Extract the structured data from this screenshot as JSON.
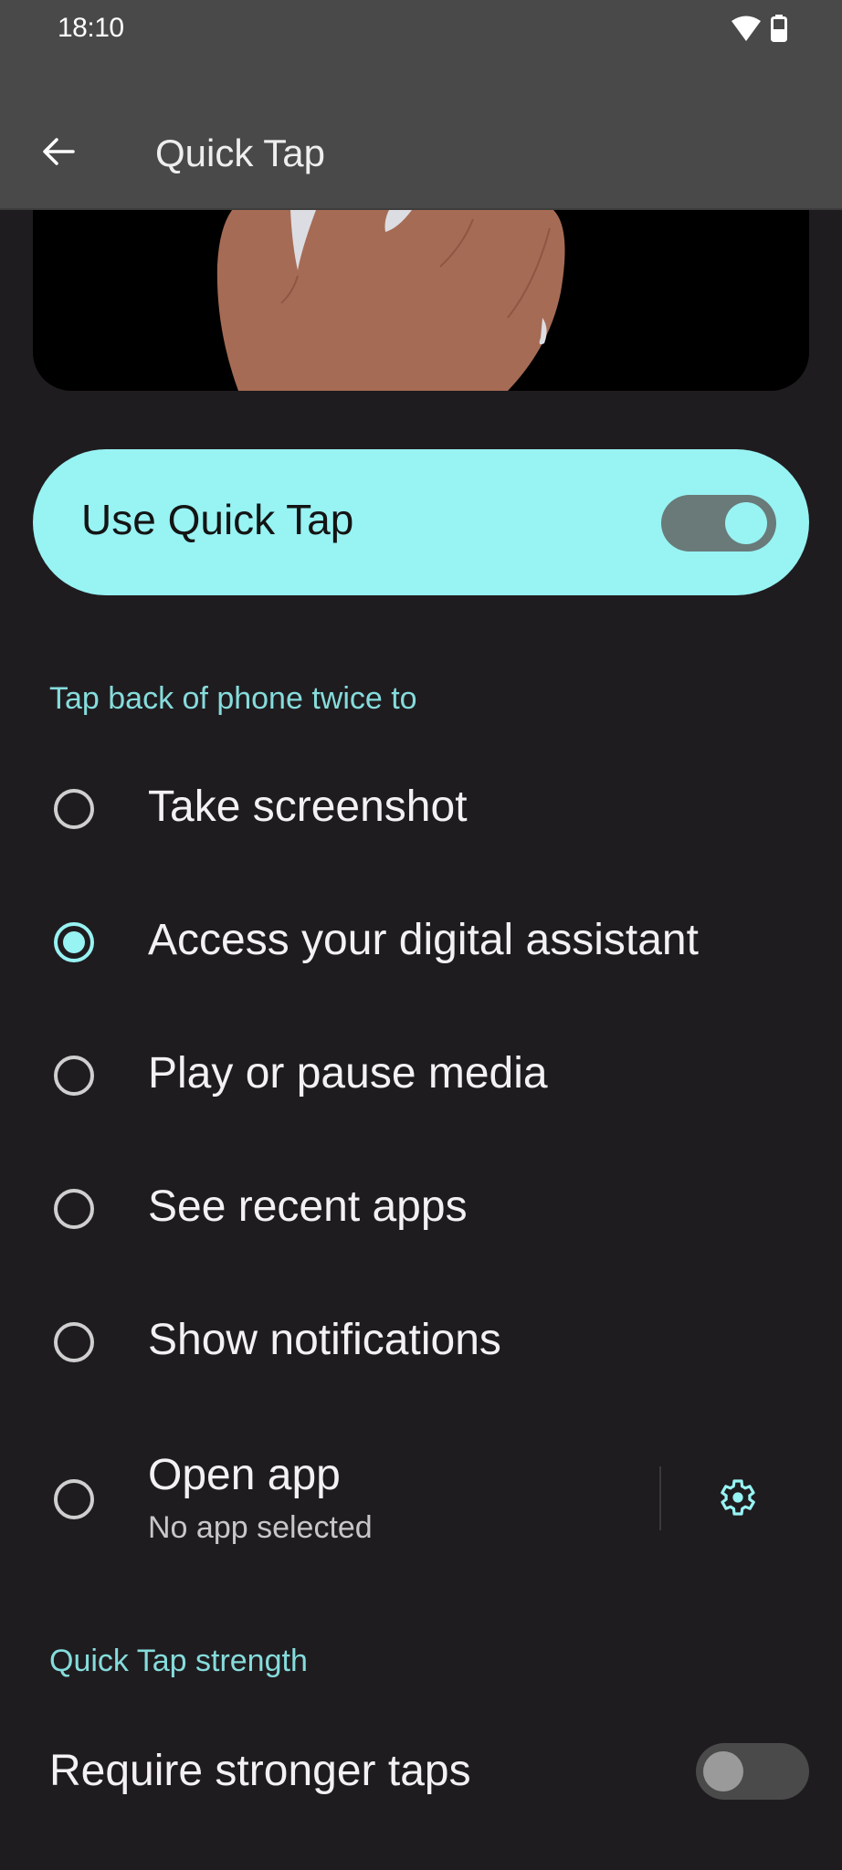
{
  "status_bar": {
    "time": "18:10",
    "icons": [
      "wifi-icon",
      "battery-icon"
    ]
  },
  "app_bar": {
    "back_icon": "arrow-back-icon",
    "title": "Quick Tap"
  },
  "illustration": {
    "description": "hand-tapping-back-of-phone"
  },
  "main_switch": {
    "label": "Use Quick Tap",
    "checked": true
  },
  "action_section": {
    "header": "Tap back of phone twice to",
    "options": [
      {
        "label": "Take screenshot",
        "checked": false
      },
      {
        "label": "Access your digital assistant",
        "checked": true
      },
      {
        "label": "Play or pause media",
        "checked": false
      },
      {
        "label": "See recent apps",
        "checked": false
      },
      {
        "label": "Show notifications",
        "checked": false
      },
      {
        "label": "Open app",
        "summary": "No app selected",
        "checked": false,
        "settings_icon": "gear-icon"
      }
    ]
  },
  "strength_section": {
    "header": "Quick Tap strength",
    "require_stronger": {
      "label": "Require stronger taps",
      "checked": false
    }
  },
  "colors": {
    "accent": "#98f3f3",
    "accent_text": "#86dcdc",
    "background": "#1f1c1f",
    "app_bar": "#484948"
  }
}
